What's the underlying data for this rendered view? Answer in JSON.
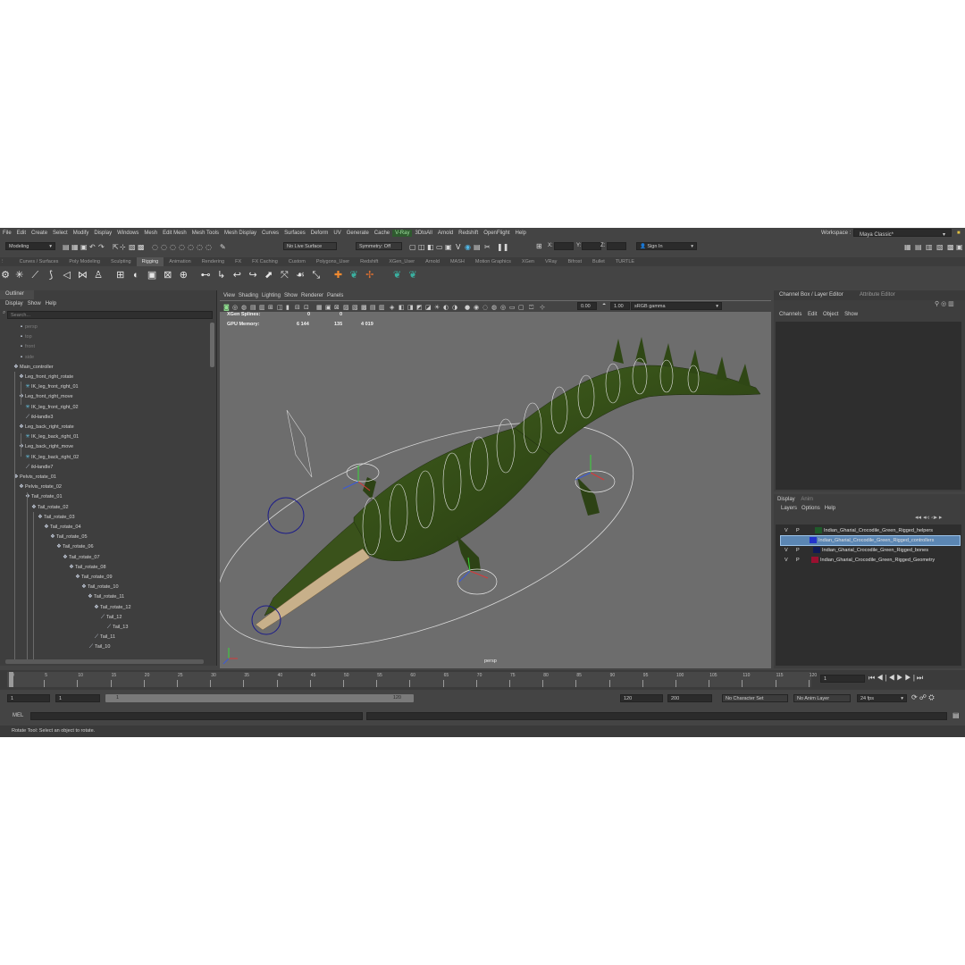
{
  "menubar": [
    "File",
    "Edit",
    "Create",
    "Select",
    "Modify",
    "Display",
    "Windows",
    "Mesh",
    "Edit Mesh",
    "Mesh Tools",
    "Mesh Display",
    "Curves",
    "Surfaces",
    "Deform",
    "UV",
    "Generate",
    "Cache",
    "V-Ray",
    "3DtoAll",
    "Arnold",
    "Redshift",
    "OpenFlight",
    "Help"
  ],
  "workspace": {
    "label": "Workspace :",
    "value": "Maya Classic*"
  },
  "status": {
    "mode": "Modeling",
    "live": "No Live Surface",
    "symmetry": "Symmetry: Off",
    "signin": "Sign In",
    "x": "X:",
    "y": "Y:",
    "z": "Z:"
  },
  "shelf_tabs": [
    "Curves / Surfaces",
    "Poly Modeling",
    "Sculpting",
    "Rigging",
    "Animation",
    "Rendering",
    "FX",
    "FX Caching",
    "Custom",
    "Polygons_User",
    "Redshift",
    "XGen_User",
    "Arnold",
    "MASH",
    "Motion Graphics",
    "XGen",
    "VRay",
    "Bifrost",
    "Bullet",
    "TURTLE"
  ],
  "outliner": {
    "title": "Outliner",
    "menu": [
      "Display",
      "Show",
      "Help"
    ],
    "search": "Search...",
    "nodes": [
      {
        "t": "persp",
        "d": true
      },
      {
        "t": "top",
        "d": true
      },
      {
        "t": "front",
        "d": true
      },
      {
        "t": "side",
        "d": true
      },
      {
        "t": "Main_controller"
      },
      {
        "t": "Leg_front_right_rotate"
      },
      {
        "t": "IK_leg_front_right_01"
      },
      {
        "t": "Leg_front_right_move"
      },
      {
        "t": "IK_leg_front_right_02"
      },
      {
        "t": "ikHandle3"
      },
      {
        "t": "Leg_back_right_rotate"
      },
      {
        "t": "IK_leg_back_right_01"
      },
      {
        "t": "Leg_back_right_move"
      },
      {
        "t": "IK_leg_back_right_02"
      },
      {
        "t": "ikHandle7"
      },
      {
        "t": "Pelvis_rotate_01"
      },
      {
        "t": "Pelvis_rotate_02"
      },
      {
        "t": "Tail_rotate_01"
      },
      {
        "t": "Tail_rotate_02"
      },
      {
        "t": "Tail_rotate_03"
      },
      {
        "t": "Tail_rotate_04"
      },
      {
        "t": "Tail_rotate_05"
      },
      {
        "t": "Tail_rotate_06"
      },
      {
        "t": "Tail_rotate_07"
      },
      {
        "t": "Tail_rotate_08"
      },
      {
        "t": "Tail_rotate_09"
      },
      {
        "t": "Tail_rotate_10"
      },
      {
        "t": "Tail_rotate_11"
      },
      {
        "t": "Tail_rotate_12"
      },
      {
        "t": "Tail_12"
      },
      {
        "t": "Tail_13"
      },
      {
        "t": "Tail_11"
      },
      {
        "t": "Tail_10"
      }
    ]
  },
  "viewport": {
    "menu": [
      "View",
      "Shading",
      "Lighting",
      "Show",
      "Renderer",
      "Panels"
    ],
    "exposure": "0.00",
    "gamma": "1.00",
    "colorspace": "sRGB gamma",
    "hud": {
      "r1": "XGen Splines:",
      "r1a": "0",
      "r1b": "0",
      "r2": "GPU Memory:",
      "r2a": "6 144",
      "r2b": "135",
      "r2c": "4 019"
    },
    "camera": "persp"
  },
  "channel": {
    "tabs": [
      "Channel Box / Layer Editor",
      "Attribute Editor"
    ],
    "menu": [
      "Channels",
      "Edit",
      "Object",
      "Show"
    ]
  },
  "layers": {
    "tabs": [
      "Display",
      "Anim"
    ],
    "menu": [
      "Layers",
      "Options",
      "Help"
    ],
    "rows": [
      {
        "v": "V",
        "p": "P",
        "name": "Indian_Gharial_Crocodile_Green_Rigged_helpers",
        "color": "#1f5a2a"
      },
      {
        "v": "",
        "p": "",
        "name": "Indian_Gharial_Crocodile_Green_Rigged_controllers",
        "color": "#2233cc"
      },
      {
        "v": "V",
        "p": "P",
        "name": "Indian_Gharial_Crocodile_Green_Rigged_bones",
        "color": "#101a55"
      },
      {
        "v": "V",
        "p": "P",
        "name": "Indian_Gharial_Crocodile_Green_Rigged_Geometry",
        "color": "#9a1030"
      }
    ]
  },
  "timeline": {
    "ticks": [
      "0",
      "5",
      "10",
      "15",
      "20",
      "25",
      "30",
      "35",
      "40",
      "45",
      "50",
      "55",
      "60",
      "65",
      "70",
      "75",
      "80",
      "85",
      "90",
      "95",
      "100",
      "105",
      "110",
      "115",
      "120"
    ],
    "current": "1"
  },
  "range": {
    "start": "1",
    "start2": "1",
    "slider_start": "1",
    "slider_end": "120",
    "end": "120",
    "end2": "200",
    "character": "No Character Set",
    "anim_layer": "No Anim Layer",
    "fps": "24 fps"
  },
  "mel": {
    "label": "MEL"
  },
  "help": "Rotate Tool: Select an object to rotate."
}
